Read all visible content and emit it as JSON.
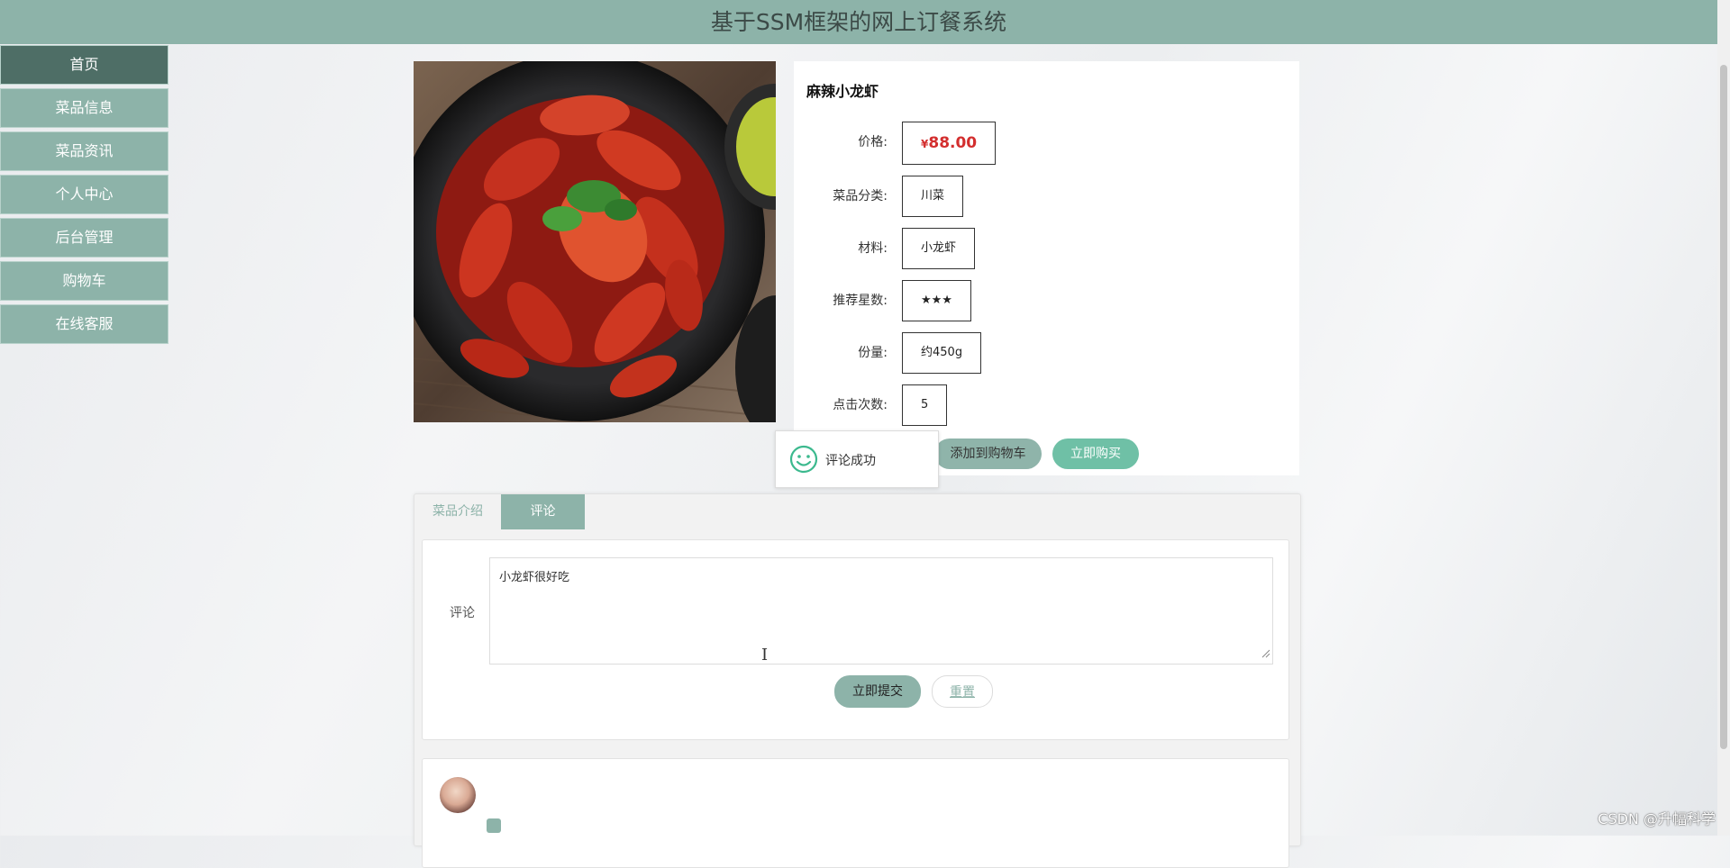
{
  "header": {
    "title": "基于SSM框架的网上订餐系统"
  },
  "sidebar": {
    "items": [
      {
        "label": "首页"
      },
      {
        "label": "菜品信息"
      },
      {
        "label": "菜品资讯"
      },
      {
        "label": "个人中心"
      },
      {
        "label": "后台管理"
      },
      {
        "label": "购物车"
      },
      {
        "label": "在线客服"
      }
    ]
  },
  "dish": {
    "name": "麻辣小龙虾",
    "currency": "¥",
    "price": "88.00",
    "fields": [
      {
        "label": "价格:"
      },
      {
        "label": "菜品分类:",
        "value": "川菜"
      },
      {
        "label": "材料:",
        "value": "小龙虾"
      },
      {
        "label": "推荐星数:",
        "value": "★★★"
      },
      {
        "label": "份量:",
        "value": "约450g"
      },
      {
        "label": "点击次数:",
        "value": "5"
      }
    ],
    "add_cart_label": "添加到购物车",
    "buy_label": "立即购买"
  },
  "toast": {
    "message": "评论成功"
  },
  "tabs": [
    {
      "label": "菜品介绍"
    },
    {
      "label": "评论"
    }
  ],
  "comment_form": {
    "label": "评论",
    "value": "小龙虾很好吃",
    "submit_label": "立即提交",
    "reset_label": "重置"
  },
  "watermark": "CSDN @升幅科学",
  "colors": {
    "accent": "#8db3a9",
    "active_nav": "#4e6e66",
    "price": "#d32e2e",
    "buy": "#6fc0a6"
  }
}
